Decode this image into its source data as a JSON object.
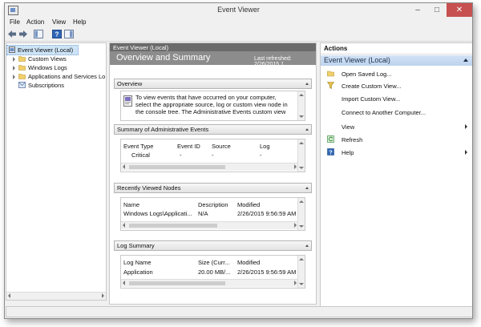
{
  "window": {
    "title": "Event Viewer"
  },
  "menu": [
    "File",
    "Action",
    "View",
    "Help"
  ],
  "tree": [
    {
      "label": "Event Viewer (Local)",
      "selected": true,
      "expandable": false,
      "indent": 0
    },
    {
      "label": "Custom Views",
      "selected": false,
      "expandable": true,
      "indent": 1
    },
    {
      "label": "Windows Logs",
      "selected": false,
      "expandable": true,
      "indent": 1
    },
    {
      "label": "Applications and Services Lo",
      "selected": false,
      "expandable": true,
      "indent": 1
    },
    {
      "label": "Subscriptions",
      "selected": false,
      "expandable": false,
      "indent": 1
    }
  ],
  "center": {
    "header": "Event Viewer (Local)",
    "title": "Overview and Summary",
    "last_refreshed": "Last refreshed: 2/26/2015 1..."
  },
  "overview": {
    "heading": "Overview",
    "text_lines": [
      "To view events that have occurred on your computer,",
      "select the appropriate source, log or custom view node in",
      "the console tree. The Administrative Events custom view"
    ]
  },
  "admin_events": {
    "heading": "Summary of Administrative Events",
    "columns": [
      "Event Type",
      "Event ID",
      "Source",
      "Log"
    ],
    "rows": [
      [
        "Critical",
        "-",
        "-",
        "-"
      ]
    ]
  },
  "recent_nodes": {
    "heading": "Recently Viewed Nodes",
    "columns": [
      "Name",
      "Description",
      "Modified"
    ],
    "rows": [
      [
        "Windows Logs\\Applicati...",
        "N/A",
        "2/26/2015 9:56:59 AM"
      ]
    ]
  },
  "log_summary": {
    "heading": "Log Summary",
    "columns": [
      "Log Name",
      "Size (Curr...",
      "Modified"
    ],
    "rows": [
      [
        "Application",
        "20.00 MB/...",
        "2/26/2015 9:56:59 AM"
      ]
    ]
  },
  "actions": {
    "heading": "Actions",
    "group": "Event Viewer (Local)",
    "items": [
      {
        "label": "Open Saved Log...",
        "icon": "folder-icon",
        "submenu": false
      },
      {
        "label": "Create Custom View...",
        "icon": "filter-icon",
        "submenu": false
      },
      {
        "label": "Import Custom View...",
        "icon": "",
        "submenu": false
      },
      {
        "label": "Connect to Another Computer...",
        "icon": "",
        "submenu": false
      },
      {
        "label": "View",
        "icon": "",
        "submenu": true
      },
      {
        "label": "Refresh",
        "icon": "refresh-icon",
        "submenu": false
      },
      {
        "label": "Help",
        "icon": "help-icon",
        "submenu": true
      }
    ]
  },
  "colors": {
    "close_button": "#c75050",
    "center_header": "#6b6b6b",
    "center_band": "#8c8c8c",
    "actions_band": "#c7daf1",
    "selection": "#cde4f7"
  }
}
